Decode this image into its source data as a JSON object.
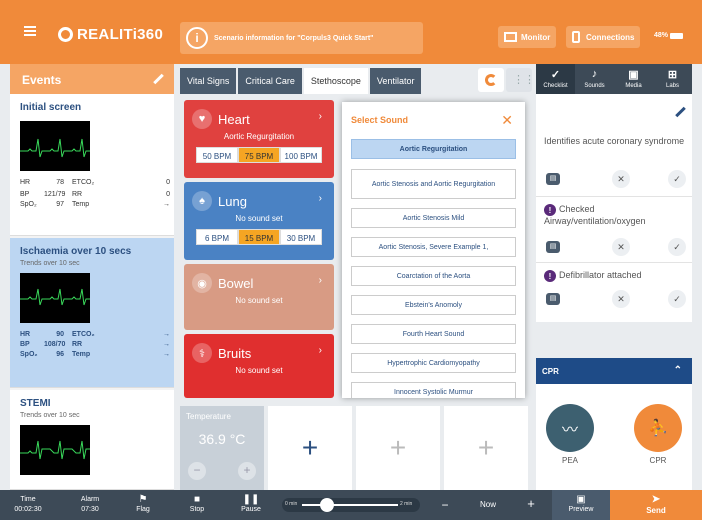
{
  "app": {
    "logo_text": "REALITi360",
    "scenario_text": "Scenario information for \"Corpuls3 Quick Start\"",
    "monitor_label": "Monitor",
    "connections_label": "Connections",
    "battery": "48%"
  },
  "events": {
    "header": "Events",
    "cards": [
      {
        "title": "Initial screen",
        "subtitle": "",
        "vitals": [
          {
            "k1": "HR",
            "v1": "78",
            "k2": "ETCO₂",
            "v2": "0"
          },
          {
            "k1": "BP",
            "v1": "121/79",
            "k2": "RR",
            "v2": "0"
          },
          {
            "k1": "SpO₂",
            "v1": "97",
            "k2": "Temp",
            "v2": "→"
          }
        ]
      },
      {
        "title": "Ischaemia over 10 secs",
        "subtitle": "Trends over 10 sec",
        "vitals": [
          {
            "k1": "HR",
            "v1": "90",
            "k2": "ETCO₂",
            "v2": "→"
          },
          {
            "k1": "BP",
            "v1": "108/70",
            "k2": "RR",
            "v2": "→"
          },
          {
            "k1": "SpO₂",
            "v1": "96",
            "k2": "Temp",
            "v2": "→"
          }
        ]
      },
      {
        "title": "STEMI",
        "subtitle": "Trends over 10 sec",
        "vitals": []
      }
    ]
  },
  "tabs": [
    "Vital Signs",
    "Critical Care",
    "Stethoscope",
    "Ventilator"
  ],
  "sounds": {
    "heart": {
      "name": "Heart",
      "value": "Aortic Regurgitation",
      "bpm": [
        "50 BPM",
        "75 BPM",
        "100 BPM"
      ],
      "color": "#e0413f"
    },
    "lung": {
      "name": "Lung",
      "value": "No sound set",
      "bpm": [
        "6 BPM",
        "15 BPM",
        "30 BPM"
      ],
      "color": "#4a82c4"
    },
    "bowel": {
      "name": "Bowel",
      "value": "No sound set",
      "color": "#d89b84"
    },
    "bruits": {
      "name": "Bruits",
      "value": "No sound set",
      "color": "#e02f2f"
    }
  },
  "temperature": {
    "label": "Temperature",
    "value": "36.9 °C"
  },
  "modal": {
    "title": "Select Sound",
    "options": [
      "Aortic Regurgitation",
      "Aortic Stenosis and Aortic Regurgitation",
      "Aortic Stenosis Mild",
      "Aortic Stenosis, Severe Example 1,",
      "Coarctation of the Aorta",
      "Ebstein's Anomoly",
      "Fourth Heart Sound",
      "Hypertrophic Cardiomyopathy",
      "Innocent Systolic Murmur"
    ]
  },
  "right_tabs": [
    "Checklist",
    "Sounds",
    "Media",
    "Labs"
  ],
  "checklist": [
    {
      "text": "Identifies acute coronary syndrome",
      "warn": false
    },
    {
      "text": "Checked Airway/ventilation/oxygen",
      "warn": true
    },
    {
      "text": "Defibrillator attached",
      "warn": true
    }
  ],
  "cpr": {
    "header": "CPR",
    "pea_label": "PEA",
    "cpr_label": "CPR"
  },
  "bottom": {
    "time_label": "Time",
    "time_value": "00:02:30",
    "alarm_label": "Alarm",
    "alarm_value": "07:30",
    "flag": "Flag",
    "stop": "Stop",
    "pause": "Pause",
    "slider_min": "0 min",
    "slider_max": "2 min",
    "now": "Now",
    "preview": "Preview",
    "send": "Send"
  }
}
